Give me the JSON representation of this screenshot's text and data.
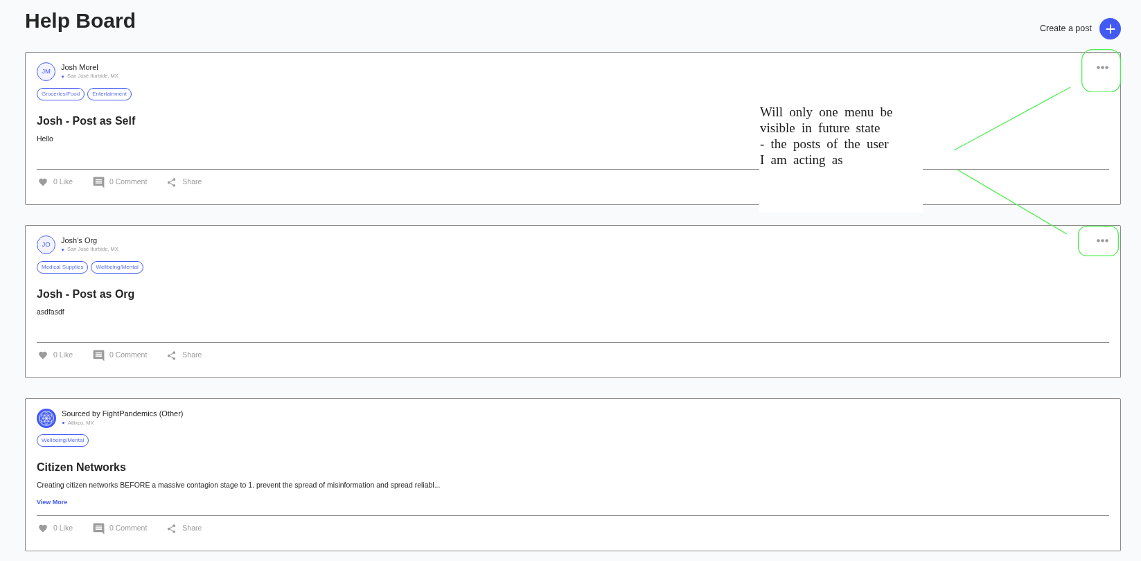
{
  "header": {
    "title": "Help Board",
    "create_post": "Create a post"
  },
  "posts": [
    {
      "author": {
        "kind": "initials",
        "initials": "JM",
        "name": "Josh Morel"
      },
      "location": "San José Iturbide, MX",
      "tags": [
        "Groceries/Food",
        "Entertainment"
      ],
      "title": "Josh - Post as Self",
      "body": "Hello",
      "actions": {
        "like": "0 Like",
        "comment": "0 Comment",
        "share": "Share"
      },
      "menu": true,
      "menu_highlighted": true
    },
    {
      "author": {
        "kind": "initials",
        "initials": "JO",
        "name": "Josh's Org"
      },
      "location": "San José Iturbide, MX",
      "tags": [
        "Medical Supplies",
        "Wellbeing/Mental"
      ],
      "title": "Josh - Post as Org",
      "body": "asdfasdf",
      "actions": {
        "like": "0 Like",
        "comment": "0 Comment",
        "share": "Share"
      },
      "menu": true,
      "menu_highlighted": true
    },
    {
      "author": {
        "kind": "logo",
        "name": "Sourced by FightPandemics (Other)"
      },
      "location": "Atlixco, MX",
      "tags": [
        "Wellbeing/Mental"
      ],
      "title": "Citizen Networks",
      "body": "Creating citizen networks BEFORE a massive contagion stage to 1. prevent the spread of misinformation and spread reliabl...",
      "view_more": "View More",
      "actions": {
        "like": "0 Like",
        "comment": "0 Comment",
        "share": "Share"
      },
      "menu": false,
      "menu_highlighted": false
    }
  ],
  "annotation": {
    "note": "Will only one menu be\nvisible in future state\n- the posts of the user\nI am acting as"
  }
}
